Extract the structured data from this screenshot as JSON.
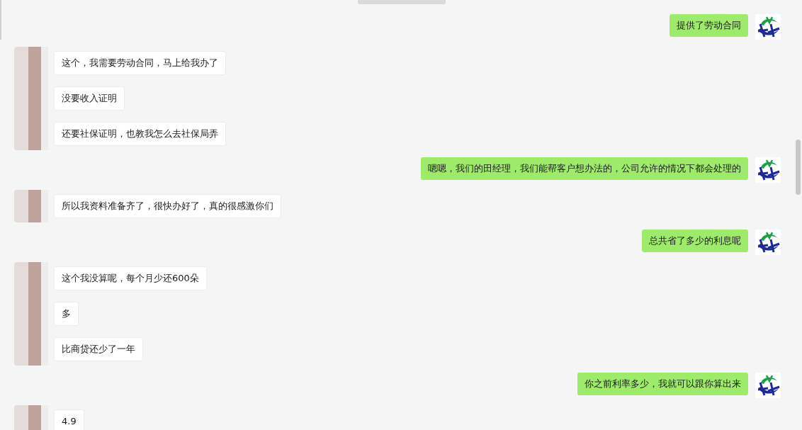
{
  "groups": [
    {
      "kind": "outgoing",
      "messages": [
        "提供了劳动合同"
      ]
    },
    {
      "kind": "incoming",
      "messages": [
        "这个，我需要劳动合同，马上给我办了",
        "没要收入证明",
        "还要社保证明，也教我怎么去社保局弄"
      ]
    },
    {
      "kind": "outgoing",
      "messages": [
        "嗯嗯，我们的田经理，我们能帮客户想办法的，公司允许的情况下都会处理的"
      ]
    },
    {
      "kind": "incoming",
      "messages": [
        "所以我资料准备齐了，很快办好了，真的很感激你们"
      ]
    },
    {
      "kind": "outgoing",
      "messages": [
        "总共省了多少的利息呢"
      ]
    },
    {
      "kind": "incoming",
      "messages": [
        "这个我没算呢，每个月少还600朵",
        "多",
        "比商贷还少了一年"
      ]
    },
    {
      "kind": "outgoing",
      "messages": [
        "你之前利率多少，我就可以跟你算出来"
      ]
    },
    {
      "kind": "incoming",
      "messages": [
        "4.9"
      ]
    }
  ]
}
